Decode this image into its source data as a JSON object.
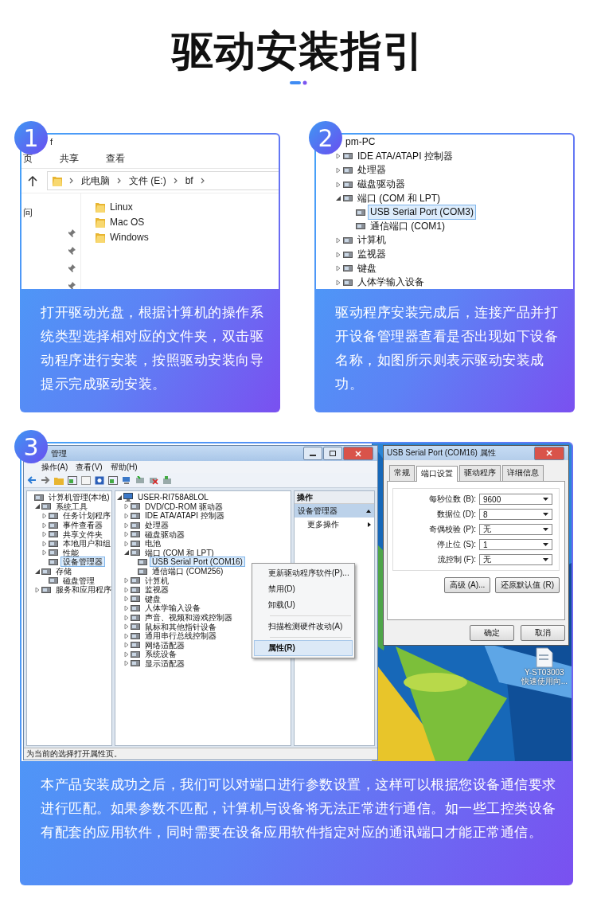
{
  "title": "驱动安装指引",
  "steps": [
    {
      "number": "1",
      "kind": "explorer",
      "screen": {
        "title": "f",
        "ribbon_tabs": [
          "页",
          "共享",
          "查看"
        ],
        "breadcrumb": [
          "此电脑",
          "文件 (E:)",
          "bf"
        ],
        "nav_label": "问",
        "files": [
          "Linux",
          "Mac OS",
          "Windows"
        ]
      },
      "text": "打开驱动光盘，根据计算机的操作系统类型选择相对应的文件夹，双击驱动程序进行安装，按照驱动安装向导提示完成驱动安装。"
    },
    {
      "number": "2",
      "kind": "device_tree",
      "screen": {
        "tree": [
          {
            "label": "pm-PC",
            "children": [
              {
                "label": "IDE ATA/ATAPI 控制器",
                "expanded": false
              },
              {
                "label": "处理器",
                "expanded": false
              },
              {
                "label": "磁盘驱动器",
                "expanded": false
              },
              {
                "label": "端口 (COM 和 LPT)",
                "expanded": true,
                "children": [
                  {
                    "label": "USB Serial Port (COM3)",
                    "selected": true
                  },
                  {
                    "label": "通信端口 (COM1)",
                    "selected": false
                  }
                ]
              },
              {
                "label": "计算机",
                "expanded": false
              },
              {
                "label": "监视器",
                "expanded": false
              },
              {
                "label": "键盘",
                "expanded": false
              },
              {
                "label": "人体学输入设备",
                "expanded": false
              }
            ]
          }
        ]
      },
      "text": "驱动程序安装完成后，连接产品并打开设备管理器查看是否出现如下设备名称，如图所示则表示驱动安装成功。"
    },
    {
      "number": "3",
      "kind": "computer_management",
      "screen": {
        "window": {
          "title": "管理",
          "menu": [
            "操作(A)",
            "查看(V)",
            "帮助(H)"
          ],
          "nav_tree": [
            {
              "label": "计算机管理(本地)",
              "children": [
                {
                  "label": "系统工具",
                  "expanded": true,
                  "children": [
                    {
                      "label": "任务计划程序",
                      "expanded": false,
                      "selected": false
                    },
                    {
                      "label": "事件查看器",
                      "expanded": false,
                      "selected": false
                    },
                    {
                      "label": "共享文件夹",
                      "expanded": false,
                      "selected": false
                    },
                    {
                      "label": "本地用户和组",
                      "expanded": false,
                      "selected": false
                    },
                    {
                      "label": "性能",
                      "expanded": false,
                      "selected": false
                    },
                    {
                      "label": "设备管理器",
                      "selected": true
                    }
                  ]
                },
                {
                  "label": "存储",
                  "expanded": true,
                  "children": [
                    {
                      "label": "磁盘管理"
                    }
                  ]
                },
                {
                  "label": "服务和应用程序",
                  "expanded": false
                }
              ]
            }
          ],
          "device_tree": [
            {
              "label": "USER-RI758A8LOL",
              "expanded": true,
              "children": [
                {
                  "label": "DVD/CD-ROM 驱动器",
                  "expanded": false
                },
                {
                  "label": "IDE ATA/ATAPI 控制器",
                  "expanded": false
                },
                {
                  "label": "处理器",
                  "expanded": false
                },
                {
                  "label": "磁盘驱动器",
                  "expanded": false
                },
                {
                  "label": "电池",
                  "expanded": false
                },
                {
                  "label": "端口 (COM 和 LPT)",
                  "expanded": true,
                  "children": [
                    {
                      "label": "USB Serial Port (COM16)",
                      "selected": true
                    },
                    {
                      "label": "通信端口 (COM256)",
                      "selected": false
                    }
                  ]
                },
                {
                  "label": "计算机",
                  "expanded": false
                },
                {
                  "label": "监视器",
                  "expanded": false
                },
                {
                  "label": "键盘",
                  "expanded": false
                },
                {
                  "label": "人体学输入设备",
                  "expanded": false
                },
                {
                  "label": "声音、视频和游戏控制器",
                  "expanded": false
                },
                {
                  "label": "鼠标和其他指针设备",
                  "expanded": false
                },
                {
                  "label": "通用串行总线控制器",
                  "expanded": false
                },
                {
                  "label": "网络适配器",
                  "expanded": false
                },
                {
                  "label": "系统设备",
                  "expanded": false
                },
                {
                  "label": "显示适配器",
                  "expanded": false
                }
              ]
            }
          ],
          "actions": {
            "header": "操作",
            "section": "设备管理器",
            "items": [
              "更多操作"
            ]
          },
          "context_menu": [
            [
              {
                "label": "更新驱动程序软件(P)...",
                "selected": false
              },
              {
                "label": "禁用(D)",
                "selected": false
              },
              {
                "label": "卸载(U)",
                "selected": false
              }
            ],
            [
              {
                "label": "扫描检测硬件改动(A)",
                "selected": false
              }
            ],
            [
              {
                "label": "属性(R)",
                "selected": true
              }
            ]
          ],
          "status": "为当前的选择打开属性页。"
        },
        "dialog": {
          "title": "USB Serial Port (COM16) 属性",
          "tabs": [
            {
              "label": "常规",
              "selected": false
            },
            {
              "label": "端口设置",
              "selected": true
            },
            {
              "label": "驱动程序",
              "selected": false
            },
            {
              "label": "详细信息",
              "selected": false
            }
          ],
          "fields": [
            {
              "label": "每秒位数 (B):",
              "value": "9600"
            },
            {
              "label": "数据位 (D):",
              "value": "8"
            },
            {
              "label": "奇偶校验 (P):",
              "value": "无"
            },
            {
              "label": "停止位 (S):",
              "value": "1"
            },
            {
              "label": "流控制 (F):",
              "value": "无"
            }
          ],
          "buttons": [
            "高级 (A)...",
            "还原默认值 (R)"
          ],
          "footer_buttons": [
            "确定",
            "取消"
          ]
        },
        "desktop_icon": {
          "label_lines": [
            "Y-ST03003",
            "快速使用向..."
          ]
        }
      },
      "text": "本产品安装成功之后，我们可以对端口进行参数设置，这样可以根据您设备通信要求进行匹配。如果参数不匹配，计算机与设备将无法正常进行通信。如一些工控类设备有配套的应用软件，同时需要在设备应用软件指定对应的通讯端口才能正常通信。"
    }
  ]
}
